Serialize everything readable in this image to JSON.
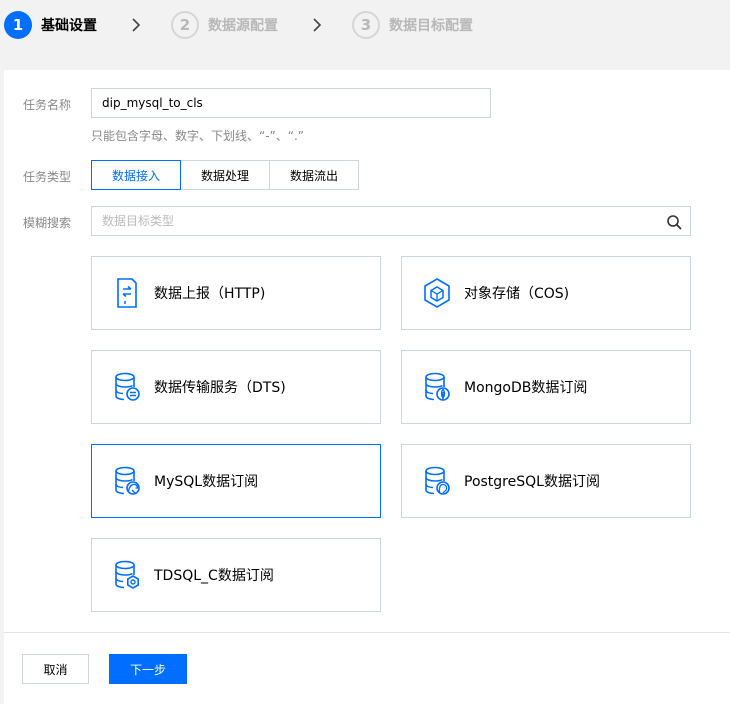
{
  "stepper": {
    "steps": [
      {
        "num": "1",
        "label": "基础设置"
      },
      {
        "num": "2",
        "label": "数据源配置"
      },
      {
        "num": "3",
        "label": "数据目标配置"
      }
    ]
  },
  "form": {
    "task_name": {
      "label": "任务名称",
      "value": "dip_mysql_to_cls",
      "hint": "只能包含字母、数字、下划线、“-”、“.”"
    },
    "task_type": {
      "label": "任务类型",
      "options": [
        "数据接入",
        "数据处理",
        "数据流出"
      ],
      "selected": "数据接入"
    },
    "fuzzy_search": {
      "label": "模糊搜索",
      "placeholder": "数据目标类型"
    }
  },
  "cards": [
    {
      "label": "数据上报（HTTP)",
      "icon": "http-report-icon"
    },
    {
      "label": "对象存储（COS)",
      "icon": "cos-cube-icon"
    },
    {
      "label": "数据传输服务（DTS)",
      "icon": "dts-database-icon"
    },
    {
      "label": "MongoDB数据订阅",
      "icon": "mongodb-database-icon"
    },
    {
      "label": "MySQL数据订阅",
      "icon": "mysql-database-icon",
      "selected": true
    },
    {
      "label": "PostgreSQL数据订阅",
      "icon": "postgresql-database-icon"
    },
    {
      "label": "TDSQL_C数据订阅",
      "icon": "tdsql-database-icon"
    }
  ],
  "footer": {
    "cancel_label": "取消",
    "next_label": "下一步"
  },
  "colors": {
    "accent": "#006eff",
    "border": "#cfd5de",
    "muted": "#888888"
  }
}
